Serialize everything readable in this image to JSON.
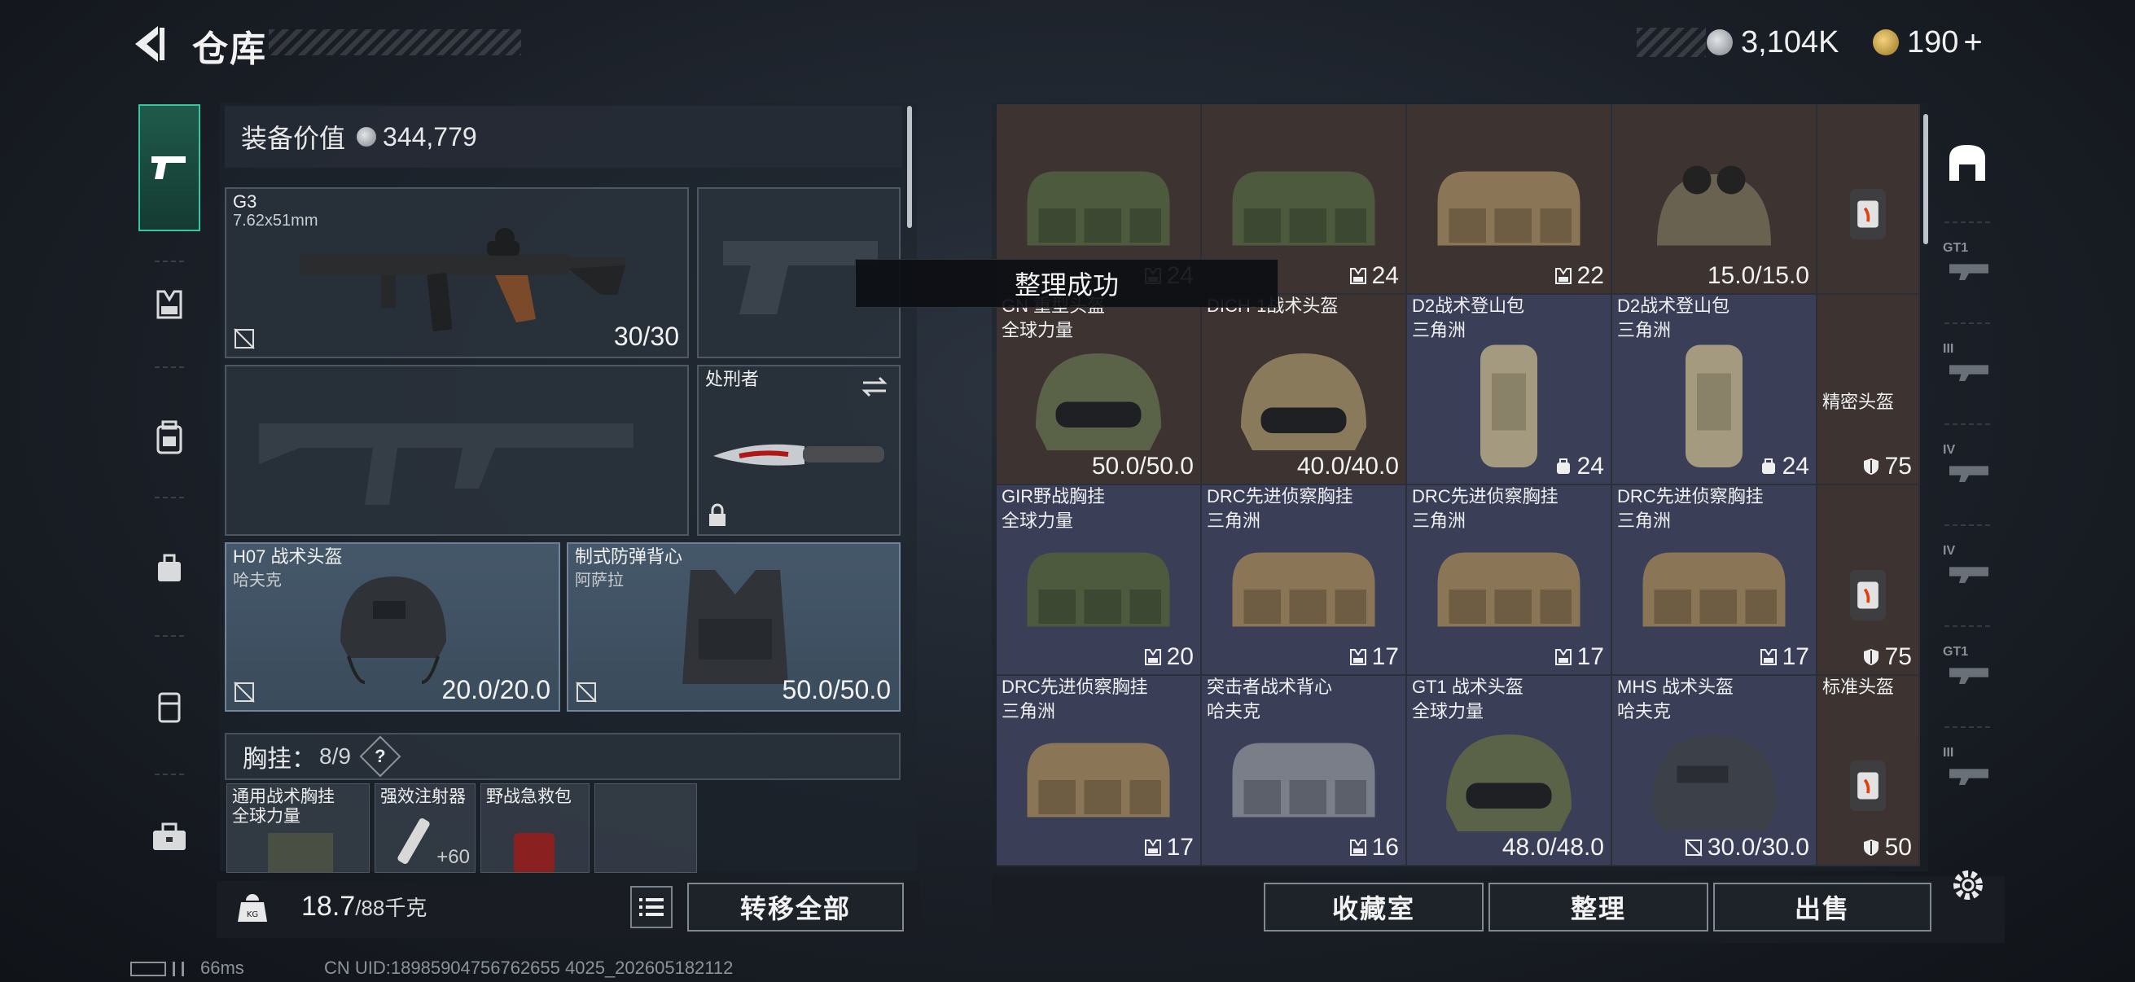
{
  "header": {
    "title": "仓库",
    "currency1": "3,104K",
    "currency2": "190",
    "add_label": "+"
  },
  "left_nav": {
    "items": [
      "pistol-icon",
      "vest-icon",
      "backpack-icon",
      "pouch-icon",
      "case-icon",
      "toolbox-icon"
    ]
  },
  "equipment": {
    "value_label": "装备价值",
    "value": "344,779",
    "primary": {
      "name": "G3",
      "caliber": "7.62x51mm",
      "durability": "30/30"
    },
    "melee": {
      "name": "处刑者"
    },
    "helmet": {
      "name": "H07 战术头盔",
      "faction": "哈夫克",
      "durability": "20.0/20.0"
    },
    "armor": {
      "name": "制式防弹背心",
      "faction": "阿萨拉",
      "durability": "50.0/50.0"
    },
    "rig": {
      "label": "胸挂：",
      "count": "8/9",
      "help": "?"
    },
    "rig_items": [
      {
        "name": "通用战术胸挂",
        "sub": "全球力量"
      },
      {
        "name": "强效注射器",
        "sub": "",
        "val": "+60"
      },
      {
        "name": "野战急救包",
        "sub": ""
      },
      {
        "name": "",
        "sub": ""
      }
    ]
  },
  "weight": {
    "current": "18.7",
    "max": "/88千克"
  },
  "buttons": {
    "transfer_all": "转移全部",
    "collection": "收藏室",
    "sort": "整理",
    "sell": "出售"
  },
  "toast": "整理成功",
  "status": {
    "ping": "66ms",
    "uid": "CN UID:18985904756762655 4025_202605182112"
  },
  "grid": [
    {
      "name": "",
      "sub": "",
      "val": "24",
      "icon": "vest-icon",
      "bg": "b",
      "art": "bag-green"
    },
    {
      "name": "",
      "sub": "",
      "val": "24",
      "icon": "vest-icon",
      "bg": "b",
      "art": "bag-green"
    },
    {
      "name": "",
      "sub": "",
      "val": "22",
      "icon": "vest-icon",
      "bg": "b",
      "art": "bag-tan"
    },
    {
      "name": "",
      "sub": "",
      "val": "15.0/15.0",
      "icon": "",
      "bg": "b",
      "art": "nvg-helmet"
    },
    {
      "name": "",
      "sub": "",
      "val": "",
      "icon": "",
      "bg": "b",
      "art": "container"
    },
    {
      "name": "GN 重型头盔",
      "sub": "全球力量",
      "val": "50.0/50.0",
      "icon": "",
      "bg": "b",
      "art": "helmet-green"
    },
    {
      "name": "DICH-1战术头盔",
      "sub": "",
      "val": "40.0/40.0",
      "icon": "",
      "bg": "b",
      "art": "helmet-tan"
    },
    {
      "name": "D2战术登山包",
      "sub": "三角洲",
      "val": "24",
      "icon": "bag-icon",
      "bg": "g",
      "art": "pack-tan"
    },
    {
      "name": "D2战术登山包",
      "sub": "三角洲",
      "val": "24",
      "icon": "bag-icon",
      "bg": "g",
      "art": "pack-tan"
    },
    {
      "name": "",
      "sub": "",
      "val": "75",
      "icon": "shield-icon",
      "bg": "b",
      "art": "none",
      "extra": "精密头盔"
    },
    {
      "name": "GIR野战胸挂",
      "sub": "全球力量",
      "val": "20",
      "icon": "vest-icon",
      "bg": "g",
      "art": "bag-green"
    },
    {
      "name": "DRC先进侦察胸挂",
      "sub": "三角洲",
      "val": "17",
      "icon": "vest-icon",
      "bg": "g",
      "art": "bag-tan"
    },
    {
      "name": "DRC先进侦察胸挂",
      "sub": "三角洲",
      "val": "17",
      "icon": "vest-icon",
      "bg": "g",
      "art": "bag-tan"
    },
    {
      "name": "DRC先进侦察胸挂",
      "sub": "三角洲",
      "val": "17",
      "icon": "vest-icon",
      "bg": "g",
      "art": "bag-tan"
    },
    {
      "name": "",
      "sub": "",
      "val": "75",
      "icon": "shield-icon",
      "bg": "b",
      "art": "container"
    },
    {
      "name": "DRC先进侦察胸挂",
      "sub": "三角洲",
      "val": "17",
      "icon": "vest-icon",
      "bg": "g",
      "art": "bag-tan"
    },
    {
      "name": "突击者战术背心",
      "sub": "哈夫克",
      "val": "16",
      "icon": "vest-icon",
      "bg": "g",
      "art": "bag-grey"
    },
    {
      "name": "GT1 战术头盔",
      "sub": "全球力量",
      "val": "48.0/48.0",
      "icon": "",
      "bg": "g",
      "art": "helmet-green"
    },
    {
      "name": "MHS 战术头盔",
      "sub": "哈夫克",
      "val": "30.0/30.0",
      "icon": "nolock-icon",
      "bg": "g",
      "art": "helmet-dark"
    },
    {
      "name": "标准头盔",
      "sub": "",
      "val": "50",
      "icon": "shield-icon",
      "bg": "b",
      "art": "container"
    }
  ],
  "right_nav": {
    "labels": [
      "",
      "GT1",
      "III",
      "IV",
      "IV",
      "GT1",
      "III"
    ]
  }
}
